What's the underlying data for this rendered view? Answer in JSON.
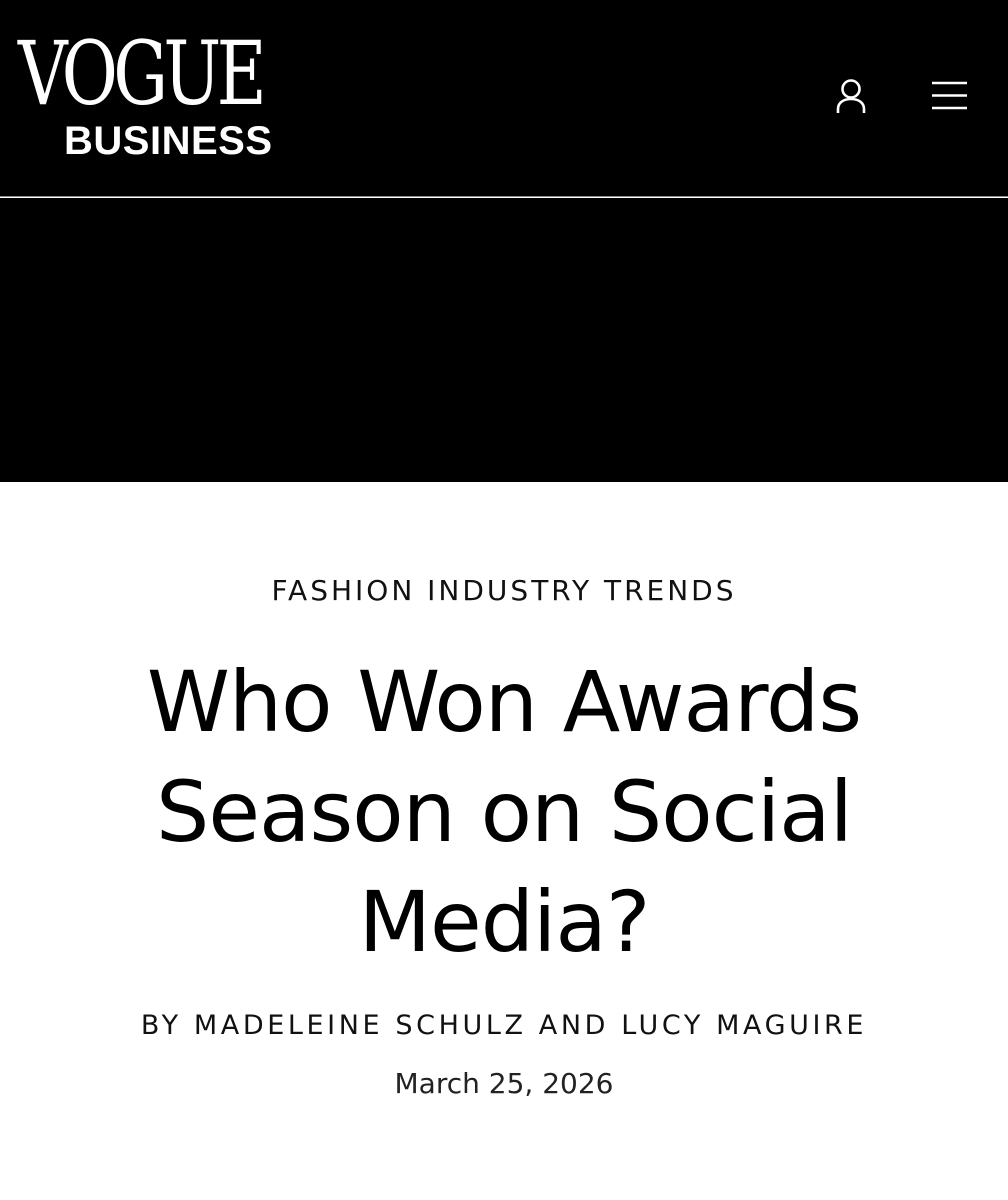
{
  "header": {
    "logo_primary": "VOGUE",
    "logo_secondary": "BUSINESS",
    "account_icon": "user-icon",
    "menu_icon": "hamburger-menu-icon",
    "background_color": "#000000"
  },
  "article": {
    "rubric": "FASHION INDUSTRY TRENDS",
    "headline": "Who Won Awards Season on Social Media?",
    "byline_prefix": "BY",
    "byline_authors": "MADELEINE SCHULZ AND LUCY MAGUIRE",
    "date": "March 25, 2026"
  }
}
